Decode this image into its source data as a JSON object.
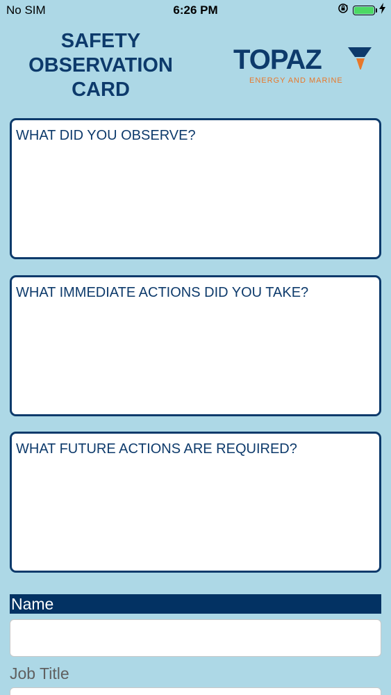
{
  "status_bar": {
    "carrier": "No SIM",
    "time": "6:26 PM",
    "battery_level": 1.0,
    "icons": [
      "orientation-lock-icon",
      "battery-icon",
      "charging-icon"
    ]
  },
  "header": {
    "title_lines": [
      "SAFETY",
      "OBSERVATION",
      "CARD"
    ],
    "logo": {
      "word": "TOPAZ",
      "tagline": "ENERGY AND MARINE"
    }
  },
  "form": {
    "observe_placeholder": "WHAT DID YOU OBSERVE?",
    "immediate_placeholder": "WHAT IMMEDIATE ACTIONS DID YOU TAKE?",
    "future_placeholder": "WHAT FUTURE ACTIONS ARE REQUIRED?",
    "name_label": "Name",
    "name_value": "",
    "job_title_label": "Job Title",
    "job_title_value": ""
  },
  "colors": {
    "background": "#add8e6",
    "navy": "#0d3a6b",
    "accent_orange": "#e8782a",
    "battery_green": "#4cd964"
  }
}
